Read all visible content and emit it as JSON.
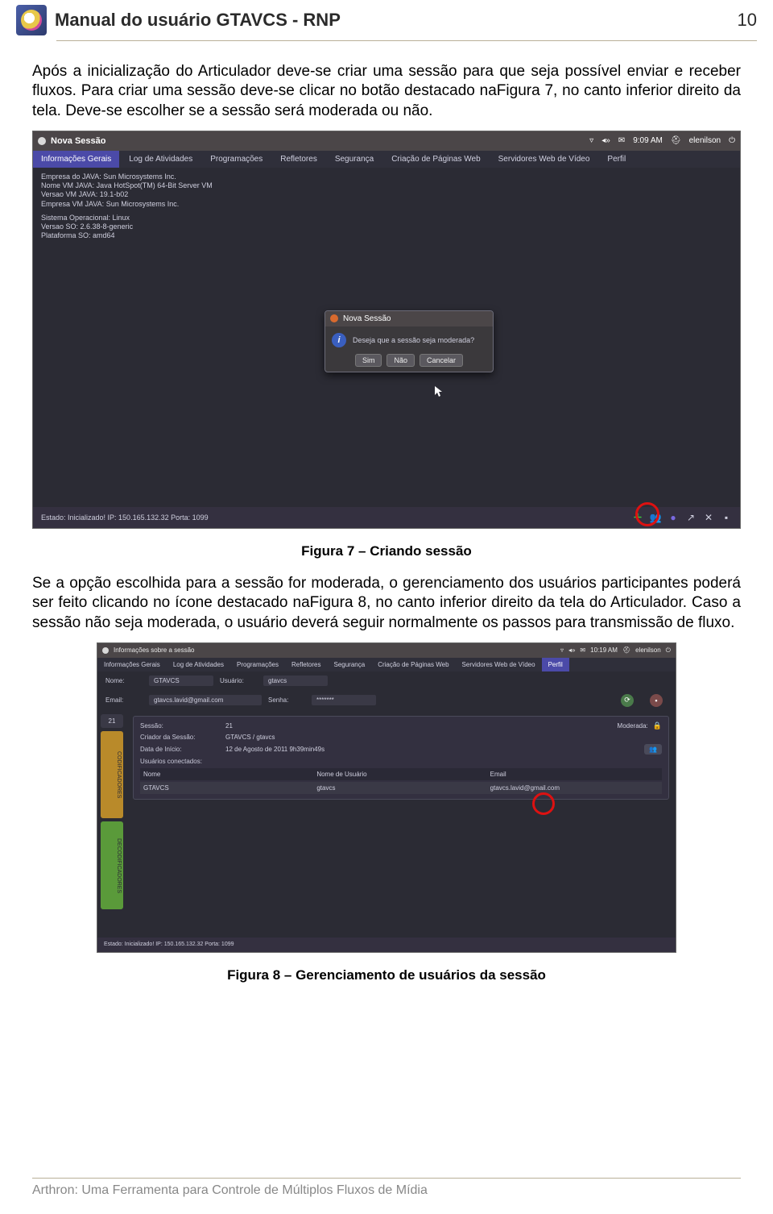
{
  "header": {
    "title": "Manual do usuário GTAVCS - RNP",
    "page_number": "10"
  },
  "para1": "Após a inicialização do Articulador deve-se criar uma sessão para que seja possível enviar e receber fluxos. Para criar uma sessão deve-se clicar no botão destacado naFigura 7, no canto inferior direito da tela. Deve-se escolher se a sessão será moderada ou não.",
  "shot1": {
    "window_title": "Nova Sessão",
    "top_right_time": "9:09 AM",
    "top_right_user": "elenilson",
    "tabs": [
      "Informações Gerais",
      "Log de Atividades",
      "Programações",
      "Refletores",
      "Segurança",
      "Criação de Páginas Web",
      "Servidores Web de Vídeo",
      "Perfil"
    ],
    "active_tab_index": 0,
    "info_lines": [
      "Empresa do JAVA: Sun Microsystems Inc.",
      "Nome VM JAVA: Java HotSpot(TM) 64-Bit Server VM",
      "Versao VM JAVA: 19.1-b02",
      "Empresa VM JAVA: Sun Microsystems Inc.",
      "",
      "Sistema Operacional: Linux",
      "Versao SO: 2.6.38-8-generic",
      "Plataforma SO: amd64"
    ],
    "dialog": {
      "title": "Nova Sessão",
      "question": "Deseja que a sessão seja moderada?",
      "buttons": [
        "Sim",
        "Não",
        "Cancelar"
      ]
    },
    "status_bar": "Estado: Inicializado! IP: 150.165.132.32 Porta: 1099"
  },
  "fig7_caption": "Figura 7 – Criando sessão",
  "para2": "Se a opção escolhida para a sessão for moderada, o gerenciamento dos usuários participantes poderá ser feito clicando no ícone destacado naFigura 8, no canto inferior direito da tela do Articulador. Caso a sessão não seja moderada, o usuário deverá seguir normalmente os passos para transmissão de fluxo.",
  "shot2": {
    "window_title": "Informações sobre a sessão",
    "top_right_time": "10:19 AM",
    "top_right_user": "elenilson",
    "tabs": [
      "Informações Gerais",
      "Log de Atividades",
      "Programações",
      "Refletores",
      "Segurança",
      "Criação de Páginas Web",
      "Servidores Web de Vídeo",
      "Perfil"
    ],
    "active_tab_index": 7,
    "fields": {
      "nome_label": "Nome:",
      "nome_value": "GTAVCS",
      "usuario_label": "Usuário:",
      "usuario_value": "gtavcs",
      "email_label": "Email:",
      "email_value": "gtavcs.lavid@gmail.com",
      "senha_label": "Senha:",
      "senha_value": "*******"
    },
    "left_tabs": [
      "CODIFICADORES",
      "DECODIFICADORES"
    ],
    "panel": {
      "sessao_label": "Sessão:",
      "sessao_value": "21",
      "moderada_label": "Moderada:",
      "criador_label": "Criador da Sessão:",
      "criador_value": "GTAVCS / gtavcs",
      "data_label": "Data de Início:",
      "data_value": "12 de Agosto de 2011 9h39min49s",
      "usuarios_label": "Usuários conectados:",
      "table_headers": [
        "Nome",
        "Nome de Usuário",
        "Email"
      ],
      "table_row": [
        "GTAVCS",
        "gtavcs",
        "gtavcs.lavid@gmail.com"
      ]
    },
    "status_bar": "Estado: Inicializado! IP: 150.165.132.32 Porta: 1099"
  },
  "fig8_caption": "Figura 8 – Gerenciamento de usuários da sessão",
  "footer": "Arthron: Uma Ferramenta para Controle de Múltiplos Fluxos de Mídia"
}
